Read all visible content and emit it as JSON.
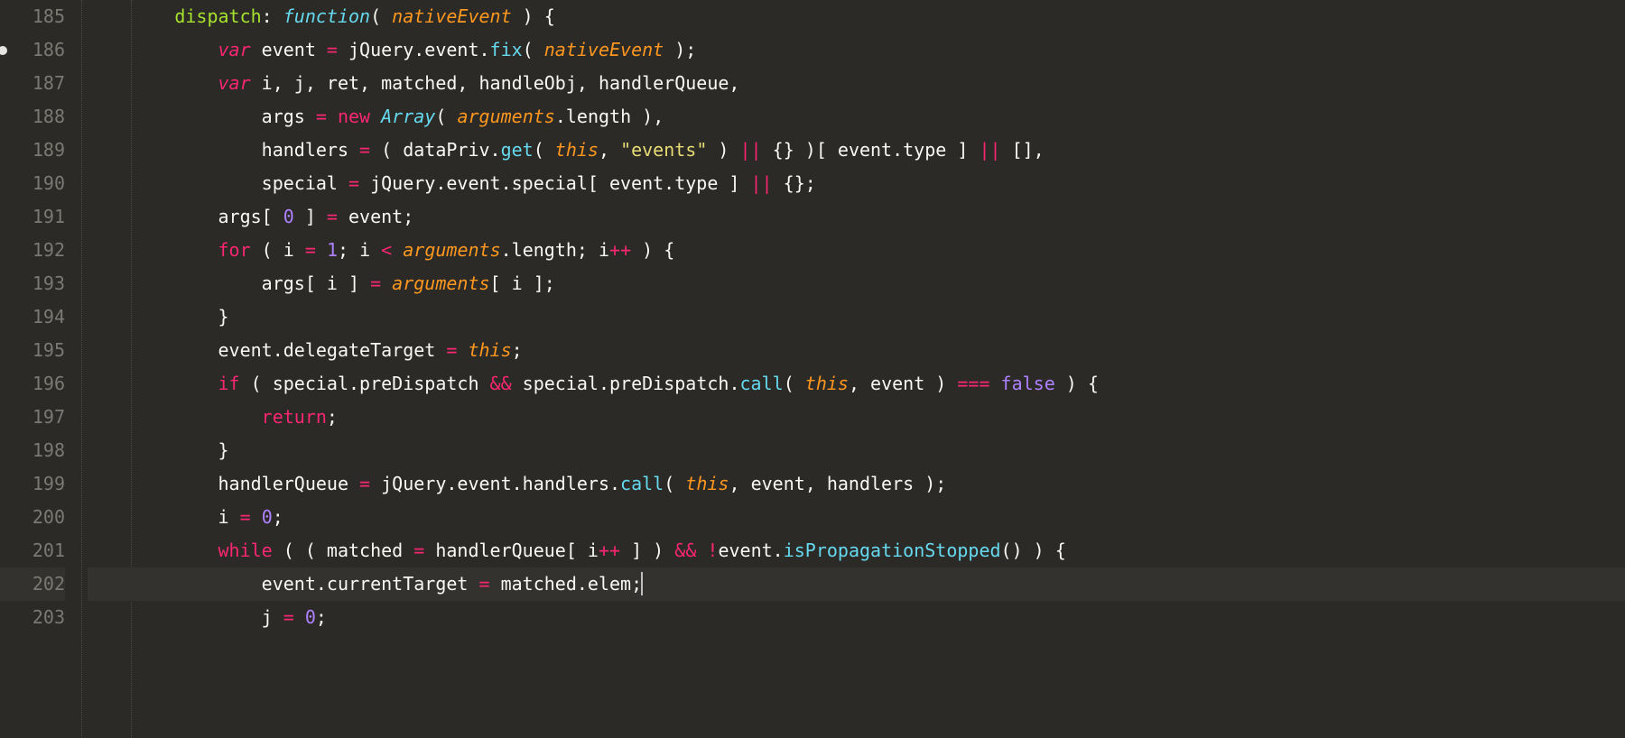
{
  "editor": {
    "currentLine": 202,
    "modifiedLines": [
      186
    ],
    "lines": [
      {
        "num": 185,
        "indent": 2,
        "tokens": [
          {
            "t": "dispatch",
            "c": "c-name"
          },
          {
            "t": ": ",
            "c": "c-plain"
          },
          {
            "t": "function",
            "c": "c-func"
          },
          {
            "t": "( ",
            "c": "c-plain"
          },
          {
            "t": "nativeEvent",
            "c": "c-param"
          },
          {
            "t": " ) {",
            "c": "c-plain"
          }
        ]
      },
      {
        "num": 186,
        "indent": 3,
        "tokens": [
          {
            "t": "var",
            "c": "c-key c-ital"
          },
          {
            "t": " event ",
            "c": "c-plain"
          },
          {
            "t": "=",
            "c": "c-op"
          },
          {
            "t": " jQuery.event.",
            "c": "c-plain"
          },
          {
            "t": "fix",
            "c": "c-prop"
          },
          {
            "t": "( ",
            "c": "c-plain"
          },
          {
            "t": "nativeEvent",
            "c": "c-param"
          },
          {
            "t": " );",
            "c": "c-plain"
          }
        ]
      },
      {
        "num": 187,
        "indent": 3,
        "tokens": [
          {
            "t": "var",
            "c": "c-key c-ital"
          },
          {
            "t": " i, j, ret, matched, handleObj, handlerQueue,",
            "c": "c-plain"
          }
        ]
      },
      {
        "num": 188,
        "indent": 4,
        "tokens": [
          {
            "t": "args ",
            "c": "c-plain"
          },
          {
            "t": "=",
            "c": "c-op"
          },
          {
            "t": " ",
            "c": "c-plain"
          },
          {
            "t": "new",
            "c": "c-op"
          },
          {
            "t": " ",
            "c": "c-plain"
          },
          {
            "t": "Array",
            "c": "c-type"
          },
          {
            "t": "( ",
            "c": "c-plain"
          },
          {
            "t": "arguments",
            "c": "c-param"
          },
          {
            "t": ".length ),",
            "c": "c-plain"
          }
        ]
      },
      {
        "num": 189,
        "indent": 4,
        "tokens": [
          {
            "t": "handlers ",
            "c": "c-plain"
          },
          {
            "t": "=",
            "c": "c-op"
          },
          {
            "t": " ( dataPriv.",
            "c": "c-plain"
          },
          {
            "t": "get",
            "c": "c-prop"
          },
          {
            "t": "( ",
            "c": "c-plain"
          },
          {
            "t": "this",
            "c": "c-param"
          },
          {
            "t": ", ",
            "c": "c-plain"
          },
          {
            "t": "\"events\"",
            "c": "c-str"
          },
          {
            "t": " ) ",
            "c": "c-plain"
          },
          {
            "t": "||",
            "c": "c-op"
          },
          {
            "t": " {} )[ event.type ] ",
            "c": "c-plain"
          },
          {
            "t": "||",
            "c": "c-op"
          },
          {
            "t": " [],",
            "c": "c-plain"
          }
        ]
      },
      {
        "num": 190,
        "indent": 4,
        "tokens": [
          {
            "t": "special ",
            "c": "c-plain"
          },
          {
            "t": "=",
            "c": "c-op"
          },
          {
            "t": " jQuery.event.special[ event.type ] ",
            "c": "c-plain"
          },
          {
            "t": "||",
            "c": "c-op"
          },
          {
            "t": " {};",
            "c": "c-plain"
          }
        ]
      },
      {
        "num": 191,
        "indent": 3,
        "tokens": [
          {
            "t": "args[ ",
            "c": "c-plain"
          },
          {
            "t": "0",
            "c": "c-num"
          },
          {
            "t": " ] ",
            "c": "c-plain"
          },
          {
            "t": "=",
            "c": "c-op"
          },
          {
            "t": " event;",
            "c": "c-plain"
          }
        ]
      },
      {
        "num": 192,
        "indent": 3,
        "tokens": [
          {
            "t": "for",
            "c": "c-op"
          },
          {
            "t": " ( i ",
            "c": "c-plain"
          },
          {
            "t": "=",
            "c": "c-op"
          },
          {
            "t": " ",
            "c": "c-plain"
          },
          {
            "t": "1",
            "c": "c-num"
          },
          {
            "t": "; i ",
            "c": "c-plain"
          },
          {
            "t": "<",
            "c": "c-op"
          },
          {
            "t": " ",
            "c": "c-plain"
          },
          {
            "t": "arguments",
            "c": "c-param"
          },
          {
            "t": ".length; i",
            "c": "c-plain"
          },
          {
            "t": "++",
            "c": "c-op"
          },
          {
            "t": " ) {",
            "c": "c-plain"
          }
        ]
      },
      {
        "num": 193,
        "indent": 4,
        "tokens": [
          {
            "t": "args[ i ] ",
            "c": "c-plain"
          },
          {
            "t": "=",
            "c": "c-op"
          },
          {
            "t": " ",
            "c": "c-plain"
          },
          {
            "t": "arguments",
            "c": "c-param"
          },
          {
            "t": "[ i ];",
            "c": "c-plain"
          }
        ]
      },
      {
        "num": 194,
        "indent": 3,
        "tokens": [
          {
            "t": "}",
            "c": "c-plain"
          }
        ]
      },
      {
        "num": 195,
        "indent": 3,
        "tokens": [
          {
            "t": "event.delegateTarget ",
            "c": "c-plain"
          },
          {
            "t": "=",
            "c": "c-op"
          },
          {
            "t": " ",
            "c": "c-plain"
          },
          {
            "t": "this",
            "c": "c-param"
          },
          {
            "t": ";",
            "c": "c-plain"
          }
        ]
      },
      {
        "num": 196,
        "indent": 3,
        "tokens": [
          {
            "t": "if",
            "c": "c-op"
          },
          {
            "t": " ( special.preDispatch ",
            "c": "c-plain"
          },
          {
            "t": "&&",
            "c": "c-op"
          },
          {
            "t": " special.preDispatch.",
            "c": "c-plain"
          },
          {
            "t": "call",
            "c": "c-prop"
          },
          {
            "t": "( ",
            "c": "c-plain"
          },
          {
            "t": "this",
            "c": "c-param"
          },
          {
            "t": ", event ) ",
            "c": "c-plain"
          },
          {
            "t": "===",
            "c": "c-op"
          },
          {
            "t": " ",
            "c": "c-plain"
          },
          {
            "t": "false",
            "c": "c-bool"
          },
          {
            "t": " ) {",
            "c": "c-plain"
          }
        ]
      },
      {
        "num": 197,
        "indent": 4,
        "tokens": [
          {
            "t": "return",
            "c": "c-op"
          },
          {
            "t": ";",
            "c": "c-plain"
          }
        ]
      },
      {
        "num": 198,
        "indent": 3,
        "tokens": [
          {
            "t": "}",
            "c": "c-plain"
          }
        ]
      },
      {
        "num": 199,
        "indent": 3,
        "tokens": [
          {
            "t": "handlerQueue ",
            "c": "c-plain"
          },
          {
            "t": "=",
            "c": "c-op"
          },
          {
            "t": " jQuery.event.handlers.",
            "c": "c-plain"
          },
          {
            "t": "call",
            "c": "c-prop"
          },
          {
            "t": "( ",
            "c": "c-plain"
          },
          {
            "t": "this",
            "c": "c-param"
          },
          {
            "t": ", event, handlers );",
            "c": "c-plain"
          }
        ]
      },
      {
        "num": 200,
        "indent": 3,
        "tokens": [
          {
            "t": "i ",
            "c": "c-plain"
          },
          {
            "t": "=",
            "c": "c-op"
          },
          {
            "t": " ",
            "c": "c-plain"
          },
          {
            "t": "0",
            "c": "c-num"
          },
          {
            "t": ";",
            "c": "c-plain"
          }
        ]
      },
      {
        "num": 201,
        "indent": 3,
        "tokens": [
          {
            "t": "while",
            "c": "c-op"
          },
          {
            "t": " ( ( matched ",
            "c": "c-plain"
          },
          {
            "t": "=",
            "c": "c-op"
          },
          {
            "t": " handlerQueue[ i",
            "c": "c-plain"
          },
          {
            "t": "++",
            "c": "c-op"
          },
          {
            "t": " ] ) ",
            "c": "c-plain"
          },
          {
            "t": "&&",
            "c": "c-op"
          },
          {
            "t": " ",
            "c": "c-plain"
          },
          {
            "t": "!",
            "c": "c-op"
          },
          {
            "t": "event.",
            "c": "c-plain"
          },
          {
            "t": "isPropagationStopped",
            "c": "c-prop"
          },
          {
            "t": "() ) {",
            "c": "c-plain"
          }
        ]
      },
      {
        "num": 202,
        "indent": 4,
        "tokens": [
          {
            "t": "event.currentTarget ",
            "c": "c-plain"
          },
          {
            "t": "=",
            "c": "c-op"
          },
          {
            "t": " matched.elem;",
            "c": "c-plain"
          }
        ],
        "cursorAfter": true
      },
      {
        "num": 203,
        "indent": 4,
        "tokens": [
          {
            "t": "j ",
            "c": "c-plain"
          },
          {
            "t": "=",
            "c": "c-op"
          },
          {
            "t": " ",
            "c": "c-plain"
          },
          {
            "t": "0",
            "c": "c-num"
          },
          {
            "t": ";",
            "c": "c-plain"
          }
        ]
      }
    ]
  }
}
